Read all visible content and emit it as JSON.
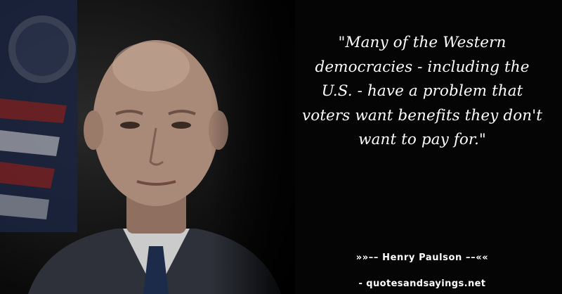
{
  "quote": {
    "text": "\"Many of the Western democracies - including the U.S. - have a problem that voters want benefits they don't want to pay for.\"",
    "author_line": "»»–– Henry Paulson ––««",
    "source": "- quotesandsayings.net"
  },
  "photo": {
    "subject": "portrait-of-man",
    "colors": {
      "background": "#000000",
      "text": "#ffffff",
      "skin": "#a98a78",
      "suit": "#3b3f4a",
      "flag_red": "#7a1f1f",
      "flag_blue": "#1b2440"
    }
  }
}
